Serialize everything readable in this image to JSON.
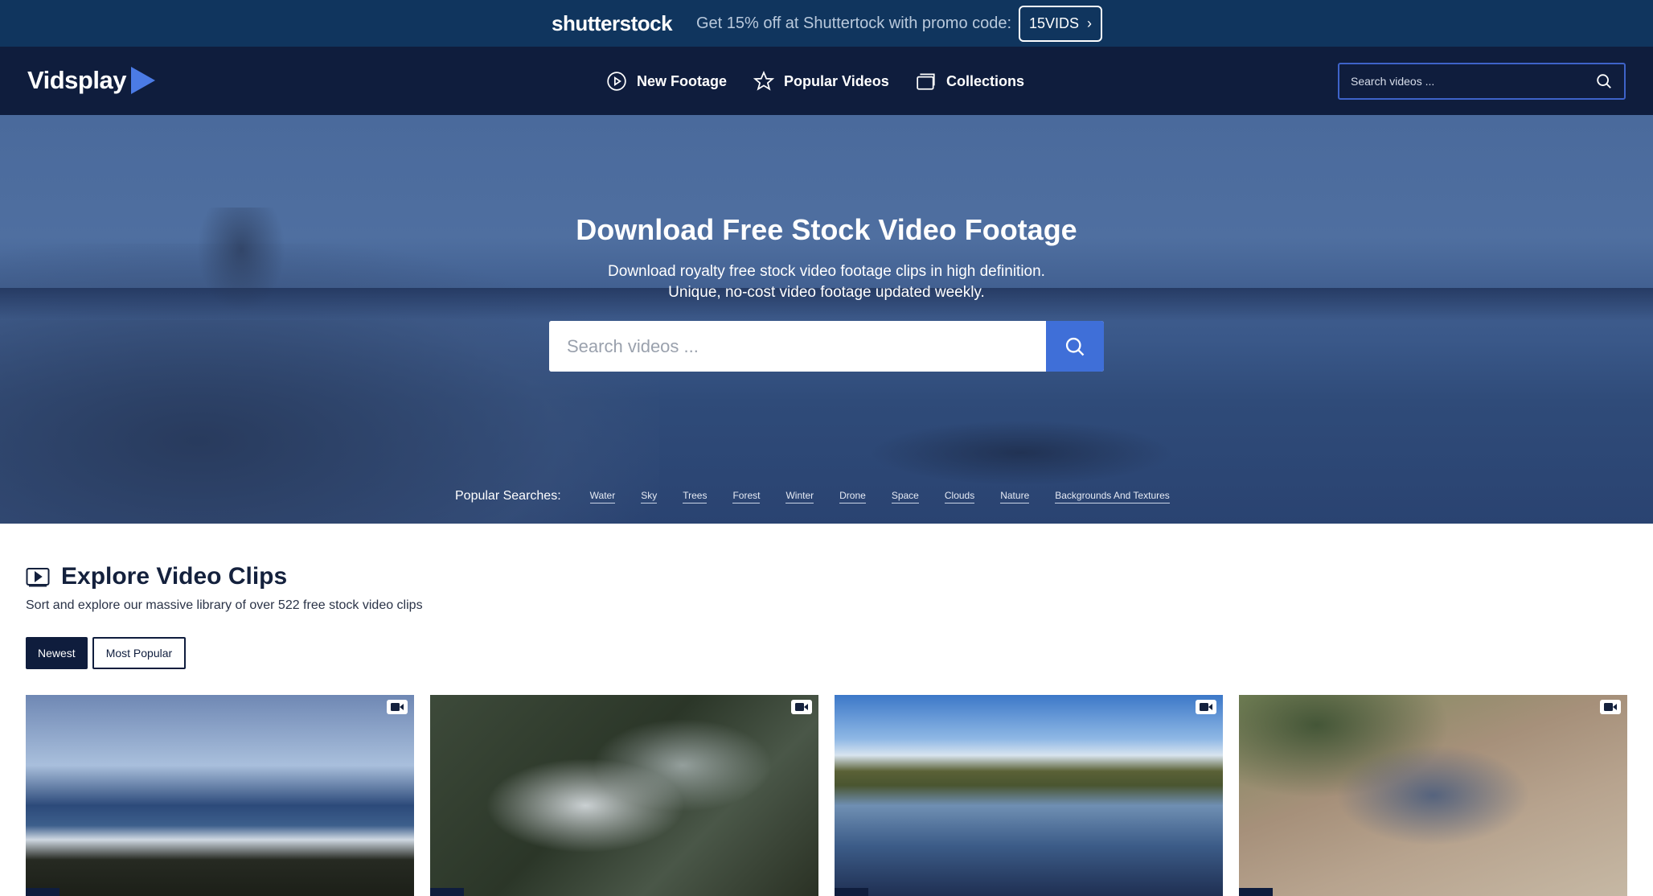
{
  "promo": {
    "brand": "shutterstock",
    "text": "Get 15% off at Shuttertock with promo code:",
    "code": "15VIDS"
  },
  "nav": {
    "logo": "Vidsplay",
    "items": [
      {
        "label": "New Footage",
        "icon": "play-circle-icon"
      },
      {
        "label": "Popular Videos",
        "icon": "star-icon"
      },
      {
        "label": "Collections",
        "icon": "collections-icon"
      }
    ],
    "search_placeholder": "Search videos ..."
  },
  "hero": {
    "title": "Download Free Stock Video Footage",
    "subtitle_line1": "Download royalty free stock video footage clips in high definition.",
    "subtitle_line2": "Unique, no-cost video footage updated weekly.",
    "search_placeholder": "Search videos ...",
    "popular_label": "Popular Searches:",
    "popular_searches": [
      "Water",
      "Sky",
      "Trees",
      "Forest",
      "Winter",
      "Drone",
      "Space",
      "Clouds",
      "Nature",
      "Backgrounds And Textures"
    ]
  },
  "explore": {
    "title": "Explore Video Clips",
    "subtitle": "Sort and explore our massive library of over 522 free stock video clips",
    "sort": {
      "newest": "Newest",
      "popular": "Most Popular"
    }
  },
  "colors": {
    "promo_bg": "#10355e",
    "nav_bg": "#0f1d3d",
    "accent": "#3f6fd8"
  }
}
